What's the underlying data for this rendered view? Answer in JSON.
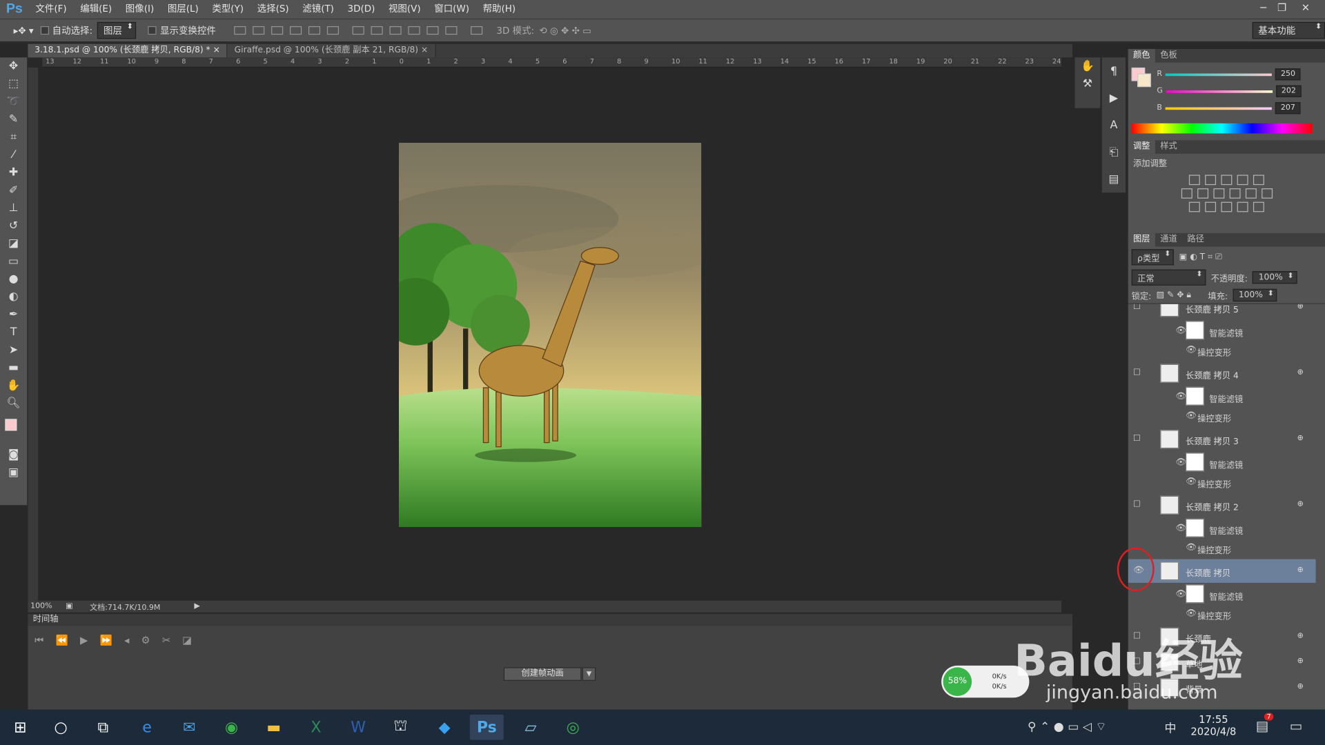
{
  "menu": [
    "文件(F)",
    "编辑(E)",
    "图像(I)",
    "图层(L)",
    "类型(Y)",
    "选择(S)",
    "滤镜(T)",
    "3D(D)",
    "视图(V)",
    "窗口(W)",
    "帮助(H)"
  ],
  "logo": "Ps",
  "options": {
    "auto_select": "自动选择:",
    "auto_select_value": "图层",
    "show_transform": "显示变换控件",
    "mode3d": "3D 模式:",
    "workspace": "基本功能"
  },
  "tabs": [
    {
      "label": "3.18.1.psd @ 100% (长颈鹿 拷贝, RGB/8) *"
    },
    {
      "label": "Giraffe.psd @ 100% (长颈鹿 副本 21, RGB/8)"
    }
  ],
  "ruler_top": [
    "13",
    "12",
    "11",
    "10",
    "9",
    "8",
    "7",
    "6",
    "5",
    "4",
    "3",
    "2",
    "1",
    "0",
    "1",
    "2",
    "3",
    "4",
    "5",
    "6",
    "7",
    "8",
    "9",
    "10",
    "11",
    "12",
    "13",
    "14",
    "15",
    "16",
    "17",
    "18",
    "19",
    "20",
    "21",
    "22",
    "23",
    "24"
  ],
  "status": {
    "zoom": "100%",
    "doc": "文档:714.7K/10.9M"
  },
  "timeline": {
    "title": "时间轴",
    "create_button": "创建帧动画"
  },
  "color_panel": {
    "tabs": [
      "颜色",
      "色板"
    ],
    "r_label": "R",
    "g_label": "G",
    "b_label": "B",
    "r": "250",
    "g": "202",
    "b": "207",
    "fg_color": "#facacf",
    "bg_color": "#f5e7c8"
  },
  "adjust_panel": {
    "tabs": [
      "调整",
      "样式"
    ],
    "title": "添加调整"
  },
  "layers_panel": {
    "tabs": [
      "图层",
      "通道",
      "路径"
    ],
    "kind": "ρ类型",
    "blend": "正常",
    "opacity_label": "不透明度:",
    "opacity": "100%",
    "lock_label": "锁定:",
    "fill_label": "填充:",
    "fill": "100%",
    "layers": [
      {
        "name": "长颈鹿 拷贝 5",
        "smart": "智能滤镜",
        "warp": "操控变形"
      },
      {
        "name": "长颈鹿 拷贝 4",
        "smart": "智能滤镜",
        "warp": "操控变形"
      },
      {
        "name": "长颈鹿 拷贝 3",
        "smart": "智能滤镜",
        "warp": "操控变形"
      },
      {
        "name": "长颈鹿 拷贝 2",
        "smart": "智能滤镜",
        "warp": "操控变形"
      },
      {
        "name": "长颈鹿 拷贝",
        "smart": "智能滤镜",
        "warp": "操控变形"
      },
      {
        "name": "长颈鹿"
      },
      {
        "name": "草地"
      },
      {
        "name": "背景"
      }
    ]
  },
  "netmeter": {
    "percent": "58%",
    "up": "0K/s",
    "down": "0K/s"
  },
  "taskbar": {
    "time": "17:55",
    "date": "2020/4/8",
    "ime": "中",
    "notif_badge": "7"
  },
  "watermark": {
    "brand": "Baidu经验",
    "url": "jingyan.baidu.com"
  }
}
